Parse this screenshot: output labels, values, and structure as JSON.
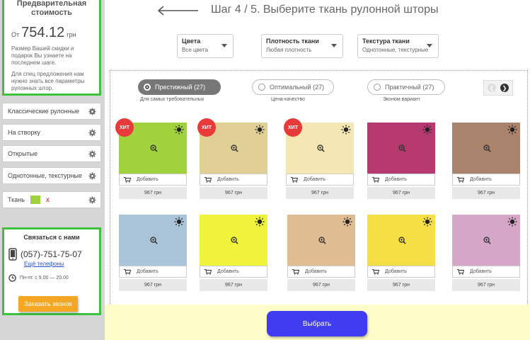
{
  "sidebar": {
    "price_title": "Предварительная стоимость",
    "price_prefix": "От",
    "price_value": "754.12",
    "price_currency": "грн",
    "price_note": "Размер Вашей скидки и подарок Вы узнаете на последнем шаге.",
    "price_note2": "Для спец предложения нам нужно знать все параметры рулонных штор.",
    "filters": [
      {
        "label": "Классические рулонные"
      },
      {
        "label": "На створку"
      },
      {
        "label": "Открытые"
      },
      {
        "label": "Однотонные, текстурные"
      },
      {
        "label": "Ткань",
        "remove": "x"
      }
    ],
    "contact_title": "Связаться с нами",
    "phone": "(057)-751-75-07",
    "more_phones": "Ещё телефоны",
    "hours": "Пн-пт. с 9.00 — 20.00",
    "callback_label": "Заказать звонок"
  },
  "header": {
    "step_title": "Шаг 4 / 5. Выберите ткань рулонной шторы"
  },
  "dropdowns": [
    {
      "label": "Цвета",
      "value": "Все цвета"
    },
    {
      "label": "Плотность ткани",
      "value": "Любая плотность"
    },
    {
      "label": "Текстура ткани",
      "value": "Однотонные, текстурные"
    }
  ],
  "tabs": [
    {
      "label": "Престижный (27)",
      "sub": "Для самых требовательных",
      "active": true
    },
    {
      "label": "Оптимальный (27)",
      "sub": "Цена-качество",
      "active": false
    },
    {
      "label": "Практичный (27)",
      "sub": "Эконом вариант",
      "active": false
    }
  ],
  "products": [
    {
      "color": "#9fd23d",
      "hit": "ХИТ",
      "add": "Добавить",
      "price": "967 грн"
    },
    {
      "color": "#e0cf95",
      "hit": "ХИТ",
      "add": "Добавить",
      "price": "967 грн"
    },
    {
      "color": "#f5e7b3",
      "hit": "ХИТ",
      "add": "Добавить",
      "price": "967 грн"
    },
    {
      "color": "#b53a70",
      "hit": "",
      "add": "Добавить",
      "price": "967 грн"
    },
    {
      "color": "#a9836b",
      "hit": "",
      "add": "Добавить",
      "price": "967 грн"
    },
    {
      "color": "#a9c4d8",
      "hit": "",
      "add": "Добавить",
      "price": "967 грн"
    },
    {
      "color": "#f0f33c",
      "hit": "",
      "add": "Добавить",
      "price": "967 грн"
    },
    {
      "color": "#e0bc92",
      "hit": "",
      "add": "Добавить",
      "price": "967 грн"
    },
    {
      "color": "#f5df45",
      "hit": "",
      "add": "Добавить",
      "price": "967 грн"
    },
    {
      "color": "#d6a6c9",
      "hit": "",
      "add": "Добавить",
      "price": "967 грн"
    }
  ],
  "footer": {
    "choose_label": "Выбрать"
  },
  "colors": {
    "accent_green": "#3cc23c",
    "callback_orange": "#f5a623",
    "choose_blue": "#3f3cf2",
    "hit_red": "#e83a3a",
    "footer_yellow": "#fefcc8"
  }
}
